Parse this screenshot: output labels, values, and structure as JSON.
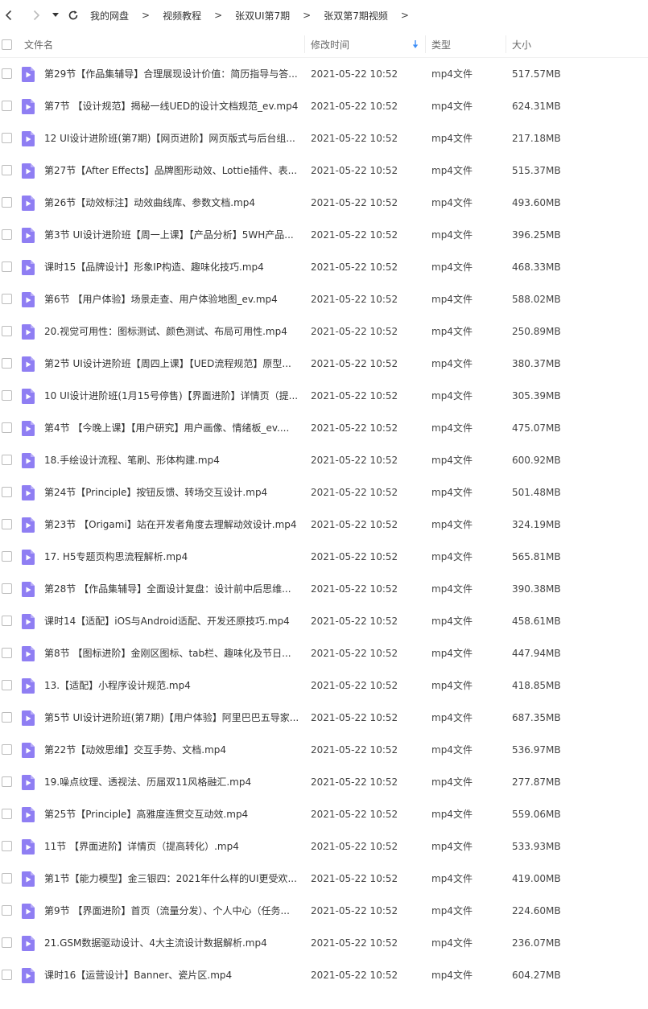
{
  "nav": {
    "back_icon": "chevron-left-icon",
    "forward_icon": "chevron-right-icon",
    "dropdown_icon": "caret-down-icon",
    "refresh_icon": "refresh-icon",
    "breadcrumbs": [
      "我的网盘",
      "视频教程",
      "张双UI第7期",
      "张双第7期视频"
    ],
    "separator": ">"
  },
  "columns": {
    "name": "文件名",
    "modified": "修改时间",
    "type": "类型",
    "size": "大小",
    "sort_icon": "sort-down-arrow-icon"
  },
  "colors": {
    "file_icon": "#8f7ef3",
    "sort_arrow": "#3d8ef7"
  },
  "files": [
    {
      "name": "第29节【作品集辅导】合理展现设计价值：简历指导与答...",
      "modified": "2021-05-22 10:52",
      "type": "mp4文件",
      "size": "517.57MB"
    },
    {
      "name": "第7节 【设计规范】揭秘一线UED的设计文档规范_ev.mp4",
      "modified": "2021-05-22 10:52",
      "type": "mp4文件",
      "size": "624.31MB"
    },
    {
      "name": "12 UI设计进阶班(第7期)【网页进阶】网页版式与后台组...",
      "modified": "2021-05-22 10:52",
      "type": "mp4文件",
      "size": "217.18MB"
    },
    {
      "name": "第27节【After Effects】品牌图形动效、Lottie插件、表...",
      "modified": "2021-05-22 10:52",
      "type": "mp4文件",
      "size": "515.37MB"
    },
    {
      "name": "第26节【动效标注】动效曲线库、参数文档.mp4",
      "modified": "2021-05-22 10:52",
      "type": "mp4文件",
      "size": "493.60MB"
    },
    {
      "name": "第3节 UI设计进阶班【周一上课】【产品分析】5WH产品...",
      "modified": "2021-05-22 10:52",
      "type": "mp4文件",
      "size": "396.25MB"
    },
    {
      "name": "课时15【品牌设计】形象IP构造、趣味化技巧.mp4",
      "modified": "2021-05-22 10:52",
      "type": "mp4文件",
      "size": "468.33MB"
    },
    {
      "name": "第6节 【用户体验】场景走查、用户体验地图_ev.mp4",
      "modified": "2021-05-22 10:52",
      "type": "mp4文件",
      "size": "588.02MB"
    },
    {
      "name": "20.视觉可用性：图标测试、颜色测试、布局可用性.mp4",
      "modified": "2021-05-22 10:52",
      "type": "mp4文件",
      "size": "250.89MB"
    },
    {
      "name": "第2节 UI设计进阶班【周四上课】【UED流程规范】原型...",
      "modified": "2021-05-22 10:52",
      "type": "mp4文件",
      "size": "380.37MB"
    },
    {
      "name": "10 UI设计进阶班(1月15号停售)【界面进阶】详情页（提...",
      "modified": "2021-05-22 10:52",
      "type": "mp4文件",
      "size": "305.39MB"
    },
    {
      "name": "第4节 【今晚上课】【用户研究】用户画像、情绪板_ev....",
      "modified": "2021-05-22 10:52",
      "type": "mp4文件",
      "size": "475.07MB"
    },
    {
      "name": "18.手绘设计流程、笔刷、形体构建.mp4",
      "modified": "2021-05-22 10:52",
      "type": "mp4文件",
      "size": "600.92MB"
    },
    {
      "name": "第24节【Principle】按钮反馈、转场交互设计.mp4",
      "modified": "2021-05-22 10:52",
      "type": "mp4文件",
      "size": "501.48MB"
    },
    {
      "name": "第23节 【Origami】站在开发者角度去理解动效设计.mp4",
      "modified": "2021-05-22 10:52",
      "type": "mp4文件",
      "size": "324.19MB"
    },
    {
      "name": "17. H5专题页构思流程解析.mp4",
      "modified": "2021-05-22 10:52",
      "type": "mp4文件",
      "size": "565.81MB"
    },
    {
      "name": "第28节 【作品集辅导】全面设计复盘：设计前中后思维...",
      "modified": "2021-05-22 10:52",
      "type": "mp4文件",
      "size": "390.38MB"
    },
    {
      "name": "课时14【适配】iOS与Android适配、开发还原技巧.mp4",
      "modified": "2021-05-22 10:52",
      "type": "mp4文件",
      "size": "458.61MB"
    },
    {
      "name": "第8节 【图标进阶】金刚区图标、tab栏、趣味化及节日...",
      "modified": "2021-05-22 10:52",
      "type": "mp4文件",
      "size": "447.94MB"
    },
    {
      "name": "13.【适配】小程序设计规范.mp4",
      "modified": "2021-05-22 10:52",
      "type": "mp4文件",
      "size": "418.85MB"
    },
    {
      "name": "第5节 UI设计进阶班(第7期)【用户体验】阿里巴巴五导家...",
      "modified": "2021-05-22 10:52",
      "type": "mp4文件",
      "size": "687.35MB"
    },
    {
      "name": "第22节【动效思维】交互手势、文档.mp4",
      "modified": "2021-05-22 10:52",
      "type": "mp4文件",
      "size": "536.97MB"
    },
    {
      "name": "19.噪点纹理、透视法、历届双11风格融汇.mp4",
      "modified": "2021-05-22 10:52",
      "type": "mp4文件",
      "size": "277.87MB"
    },
    {
      "name": "第25节【Principle】高雅度连贯交互动效.mp4",
      "modified": "2021-05-22 10:52",
      "type": "mp4文件",
      "size": "559.06MB"
    },
    {
      "name": "11节 【界面进阶】详情页（提高转化）.mp4",
      "modified": "2021-05-22 10:52",
      "type": "mp4文件",
      "size": "533.93MB"
    },
    {
      "name": "第1节【能力模型】金三银四：2021年什么样的UI更受欢...",
      "modified": "2021-05-22 10:52",
      "type": "mp4文件",
      "size": "419.00MB"
    },
    {
      "name": "第9节 【界面进阶】首页（流量分发）、个人中心（任务...",
      "modified": "2021-05-22 10:52",
      "type": "mp4文件",
      "size": "224.60MB"
    },
    {
      "name": "21.GSM数据驱动设计、4大主流设计数据解析.mp4",
      "modified": "2021-05-22 10:52",
      "type": "mp4文件",
      "size": "236.07MB"
    },
    {
      "name": "课时16【运营设计】Banner、瓷片区.mp4",
      "modified": "2021-05-22 10:52",
      "type": "mp4文件",
      "size": "604.27MB"
    }
  ]
}
